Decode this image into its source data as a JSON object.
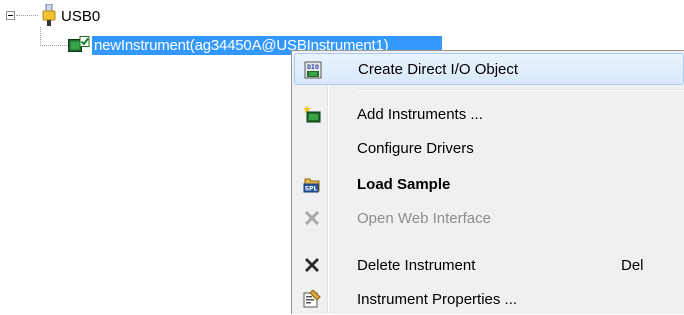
{
  "tree": {
    "root_label": "USB0",
    "child_label": "newInstrument(ag34450A@USBInstrument1)"
  },
  "menu": {
    "items": [
      {
        "label": "Create Direct I/O Object",
        "icon": "direct-io-icon",
        "state": "highlighted"
      },
      {
        "label": "Add Instruments ...",
        "icon": "add-instrument-icon",
        "state": "normal"
      },
      {
        "label": "Configure Drivers",
        "icon": "",
        "state": "normal"
      },
      {
        "label": "Load Sample",
        "icon": "spl-load-icon",
        "state": "bold"
      },
      {
        "label": "Open Web Interface",
        "icon": "web-interface-icon",
        "state": "disabled"
      },
      {
        "label": "Delete Instrument",
        "shortcut": "Del",
        "icon": "delete-icon",
        "state": "normal"
      },
      {
        "label": "Instrument Properties ...",
        "icon": "properties-icon",
        "state": "normal"
      }
    ]
  },
  "colors": {
    "selection": "#3399ff",
    "menu_bg": "#f0f0f0",
    "highlight_border": "#a8cbf1",
    "disabled_text": "#8d8d8d"
  }
}
